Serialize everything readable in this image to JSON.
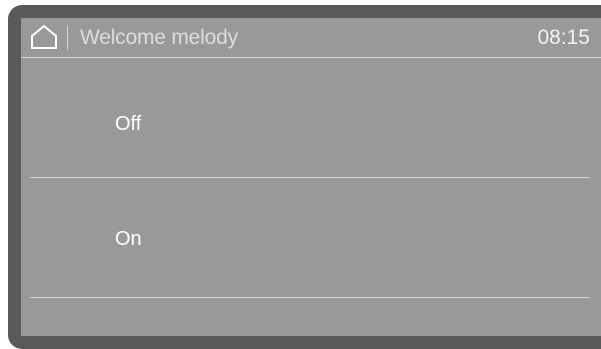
{
  "header": {
    "home_icon": "home-icon",
    "title": "Welcome melody",
    "time": "08:15"
  },
  "options": [
    {
      "label": "Off"
    },
    {
      "label": "On"
    }
  ],
  "colors": {
    "bezel": "#58595b",
    "screen": "#98999b",
    "divider": "#d4d5d7",
    "text": "#ffffff"
  }
}
